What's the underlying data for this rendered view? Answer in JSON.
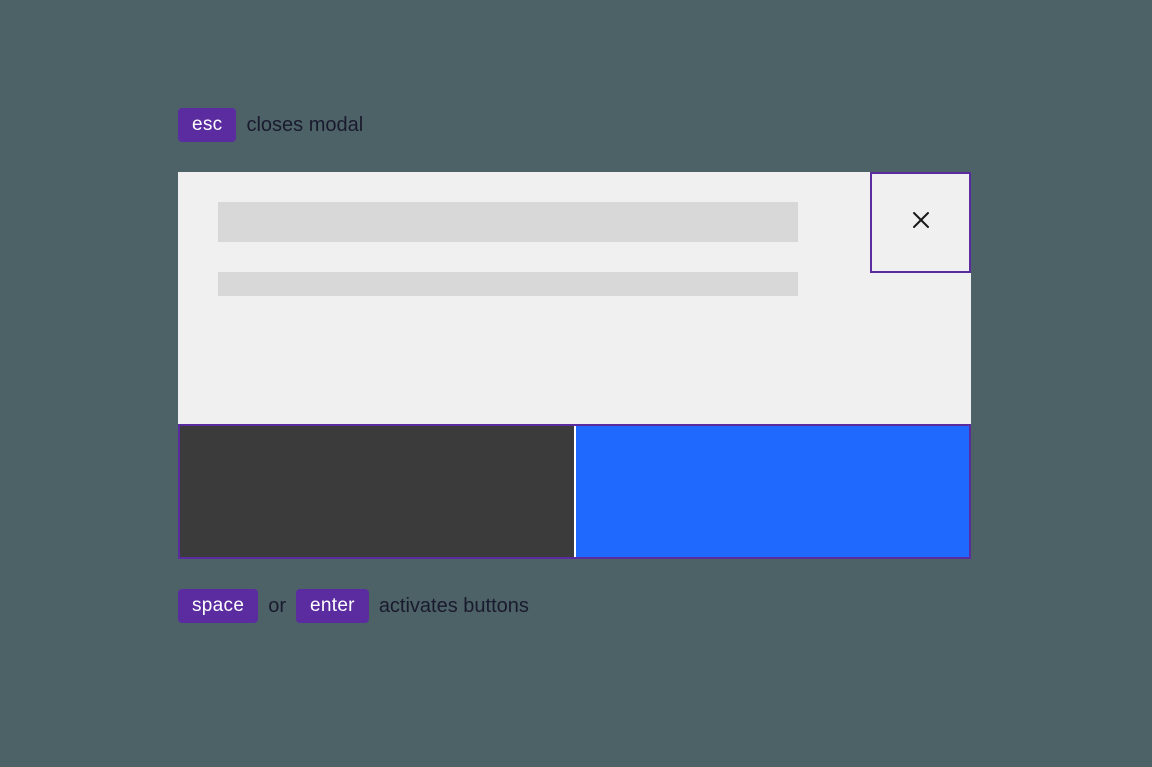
{
  "annotations": {
    "top": {
      "key": "esc",
      "text": "closes modal"
    },
    "bottom": {
      "key1": "space",
      "separator": "or",
      "key2": "enter",
      "text": "activates buttons"
    }
  },
  "modal": {
    "close_icon": "close",
    "footer": {
      "secondary_button": "",
      "primary_button": ""
    }
  },
  "colors": {
    "background": "#4d6267",
    "key_badge": "#5a2ca0",
    "modal_bg": "#f0f0f0",
    "placeholder": "#d8d8d8",
    "highlight_border": "#5a2ca0",
    "secondary_button": "#3b3b3b",
    "primary_button": "#1f69ff"
  }
}
